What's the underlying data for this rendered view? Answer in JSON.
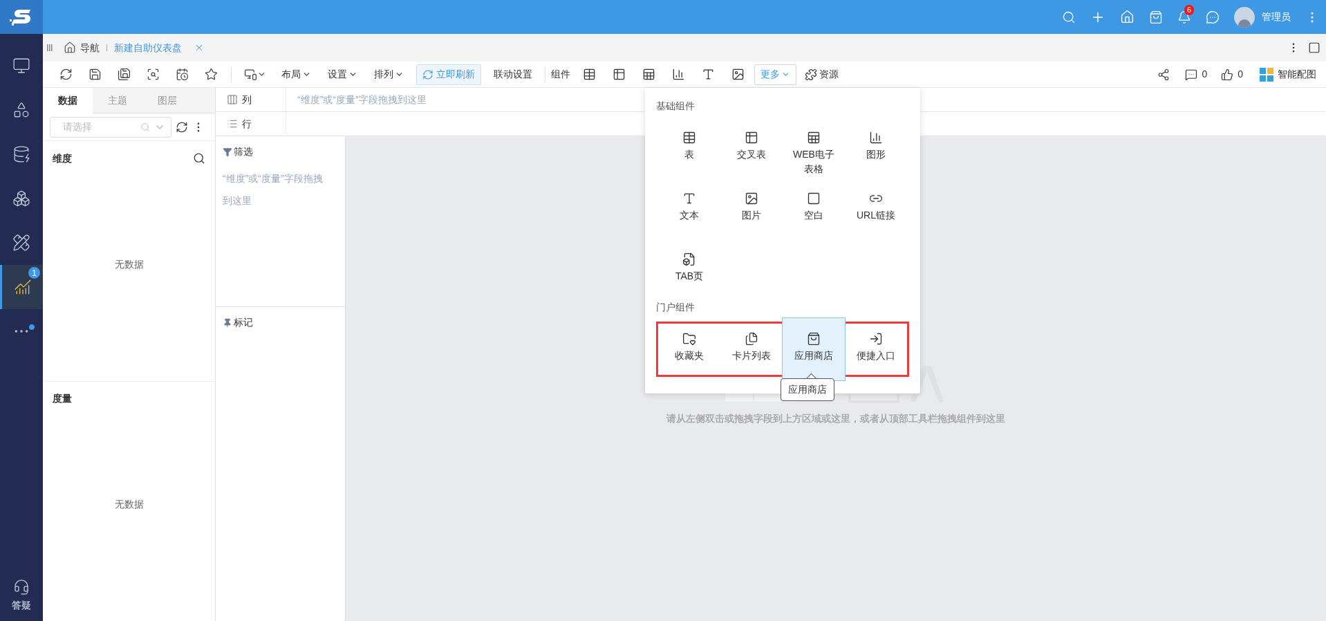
{
  "top_bar": {
    "notification_badge": "6",
    "user_name": "管理员"
  },
  "tab_bar": {
    "nav_label": "导航",
    "tabs": [
      {
        "label": "新建自助仪表盘",
        "selected": true
      }
    ]
  },
  "left_nav": {
    "items": [
      {
        "selected": false
      },
      {
        "selected": false
      },
      {
        "selected": false
      },
      {
        "selected": false
      },
      {
        "selected": false
      },
      {
        "selected": true,
        "badge": "1"
      },
      {
        "selected": false,
        "dot": true
      }
    ],
    "help_label": "答疑"
  },
  "toolbar": {
    "menus": [
      "布局",
      "设置",
      "排列"
    ],
    "refresh_button": "立即刷新",
    "link_settings": "联动设置",
    "components_label": "组件",
    "more_button": {
      "label": "更多",
      "open": true
    },
    "resources": "资源",
    "comments": "0",
    "likes": "0",
    "smart_chart": "智能配图"
  },
  "data_panel": {
    "tabs": [
      {
        "label": "数据",
        "selected": true
      },
      {
        "label": "主题",
        "selected": false
      },
      {
        "label": "图层",
        "selected": false
      }
    ],
    "search": {
      "placeholder": "请选择"
    },
    "sections": [
      {
        "title": "维度",
        "empty_text": "无数据"
      },
      {
        "title": "度量",
        "empty_text": "无数据"
      }
    ]
  },
  "shelves": [
    {
      "label": "列",
      "placeholder": "“维度”或“度量”字段拖拽到这里"
    },
    {
      "label": "行"
    }
  ],
  "filter": {
    "label": "筛选",
    "placeholder": "“维度”或“度量”字段拖拽到这里"
  },
  "marks": {
    "label": "标记"
  },
  "canvas": {
    "hint": "请从左侧双击或拖拽字段到上方区域或这里，或者从顶部工具栏拖拽组件到这里"
  },
  "more_menu": {
    "groups": [
      {
        "title": "基础组件",
        "highlighted": false,
        "items": [
          {
            "label": "表",
            "selected": false
          },
          {
            "label": "交叉表",
            "selected": false
          },
          {
            "label": "WEB电子表格",
            "selected": false
          },
          {
            "label": "图形",
            "selected": false
          },
          {
            "label": "文本",
            "selected": false
          },
          {
            "label": "图片",
            "selected": false
          },
          {
            "label": "空白",
            "selected": false
          },
          {
            "label": "URL链接",
            "selected": false
          },
          {
            "label": "TAB页",
            "selected": false
          }
        ]
      },
      {
        "title": "门户组件",
        "highlighted": true,
        "items": [
          {
            "label": "收藏夹",
            "selected": false
          },
          {
            "label": "卡片列表",
            "selected": false
          },
          {
            "label": "应用商店",
            "selected": true
          },
          {
            "label": "便捷入口",
            "selected": false
          }
        ]
      }
    ],
    "tooltip": "应用商店"
  }
}
